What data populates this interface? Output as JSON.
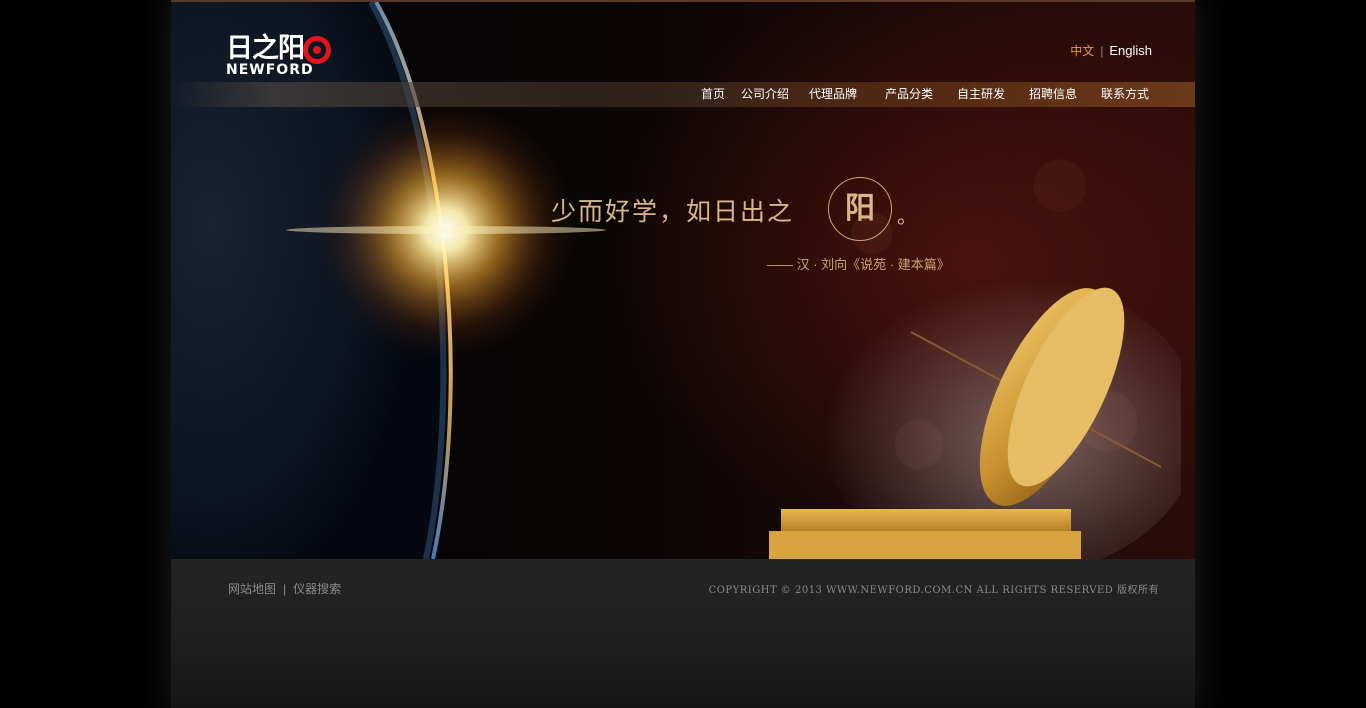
{
  "header": {
    "logo": {
      "cn": "日之阳",
      "en": "NEWFORD"
    },
    "language": {
      "zh": "中文",
      "separator": "|",
      "en": "English"
    }
  },
  "nav": {
    "items": [
      {
        "label": "首页"
      },
      {
        "label": "公司介绍"
      },
      {
        "label": "代理品牌"
      },
      {
        "label": "产品分类"
      },
      {
        "label": "自主研发"
      },
      {
        "label": "招聘信息"
      },
      {
        "label": "联系方式"
      }
    ]
  },
  "hero": {
    "quote": "少而好学，如日出之",
    "highlight": "阳",
    "period": "。",
    "attribution": "—— 汉 · 刘向《说苑 · 建本篇》"
  },
  "footer": {
    "links": [
      {
        "label": "网站地图"
      },
      {
        "label": "仪器搜索"
      }
    ],
    "separator": "|",
    "copyright": "COPYRIGHT © 2013 WWW.NEWFORD.COM.CN ALL RIGHTS RESERVED 版权所有"
  },
  "colors": {
    "accent": "#e6a020",
    "logo_red": "#e2151c",
    "quote_gold": "#d8b88a"
  }
}
